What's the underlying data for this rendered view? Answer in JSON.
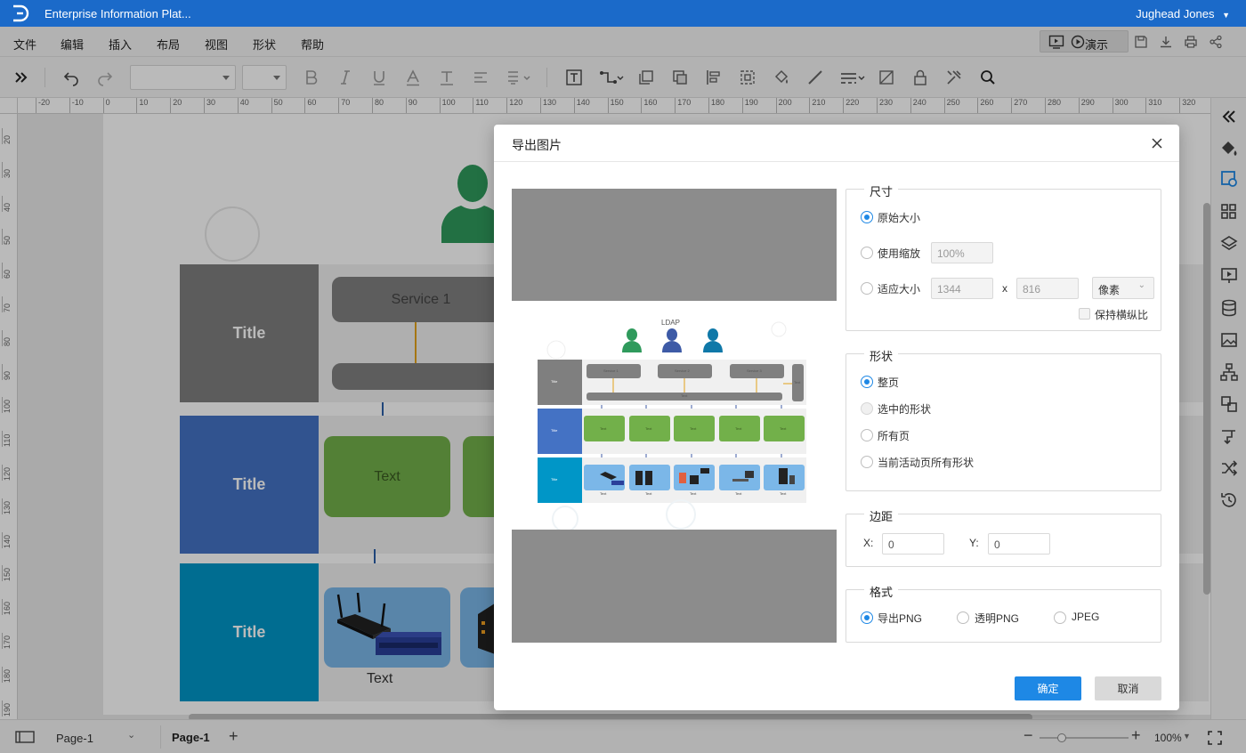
{
  "titlebar": {
    "app_title": "Enterprise Information Plat...",
    "user": "Jughead Jones"
  },
  "menu": {
    "items": [
      "文件",
      "编辑",
      "插入",
      "布局",
      "视图",
      "形状",
      "帮助"
    ],
    "present_label": "演示"
  },
  "ruler": {
    "h_ticks": [
      "-20",
      "-10",
      "0",
      "10",
      "20",
      "30",
      "40",
      "50",
      "60",
      "70",
      "80",
      "90",
      "100",
      "110",
      "120",
      "130",
      "140",
      "150",
      "160",
      "170",
      "180",
      "190",
      "200",
      "210",
      "220",
      "230",
      "240",
      "250",
      "260",
      "270",
      "280",
      "290",
      "300",
      "310",
      "320"
    ],
    "v_ticks": [
      "20",
      "30",
      "40",
      "50",
      "60",
      "70",
      "80",
      "90",
      "100",
      "110",
      "120",
      "130",
      "140",
      "150",
      "160",
      "170",
      "180",
      "190"
    ]
  },
  "canvas": {
    "titles": [
      "Title",
      "Title",
      "Title"
    ],
    "service_label": "Service 1",
    "green_label": "Text",
    "device_label": "Text"
  },
  "dialog": {
    "title": "导出图片",
    "preview": {
      "ldap": "LDAP",
      "lane_titles": [
        "Title",
        "Title",
        "Title"
      ],
      "services": [
        "Service 1",
        "Service 2",
        "Service 3"
      ],
      "bar_text": "Text",
      "green_texts": [
        "Text",
        "Text",
        "Text",
        "Text",
        "Text"
      ],
      "device_texts": [
        "Text",
        "Text",
        "Text",
        "Text",
        "Text"
      ],
      "side_text": "Text"
    },
    "size": {
      "legend": "尺寸",
      "original": "原始大小",
      "scale": "使用缩放",
      "scale_value": "100%",
      "fit": "适应大小",
      "width": "1344",
      "x_sep": "x",
      "height": "816",
      "unit": "像素",
      "keep_ratio": "保持横纵比",
      "selected": "original"
    },
    "shape": {
      "legend": "形状",
      "options": [
        "整页",
        "选中的形状",
        "所有页",
        "当前活动页所有形状"
      ],
      "selected": 0
    },
    "margin": {
      "legend": "边距",
      "x_label": "X:",
      "x_value": "0",
      "y_label": "Y:",
      "y_value": "0"
    },
    "format": {
      "legend": "格式",
      "options": [
        "导出PNG",
        "透明PNG",
        "JPEG"
      ],
      "selected": 0
    },
    "ok": "确定",
    "cancel": "取消"
  },
  "statusbar": {
    "page_select": "Page-1",
    "page_tab": "Page-1",
    "zoom": "100%"
  },
  "colors": {
    "brand": "#1b6ac9",
    "primary_button": "#1e88e5",
    "lane_gray": "#7f7f7f",
    "lane_blue": "#4472c4",
    "lane_cyan": "#0096c7",
    "green": "#72b04a",
    "device_blue": "#7bb7e8"
  },
  "icons": {
    "toolbar": [
      "expand-icon",
      "undo-icon",
      "redo-icon",
      "bold-icon",
      "italic-icon",
      "underline-icon",
      "font-color-icon",
      "text-style-icon",
      "align-icon",
      "spacing-icon",
      "textbox-icon",
      "connector-icon",
      "container-icon",
      "group-icon",
      "align-shapes-icon",
      "size-icon",
      "fill-icon",
      "line-icon",
      "line-style-icon",
      "shadow-icon",
      "lock-icon",
      "tools-icon",
      "search-icon"
    ],
    "right_panel": [
      "collapse-icon",
      "fill-panel-icon",
      "format-panel-icon",
      "grid-icon",
      "layers-icon",
      "presentation-icon",
      "data-icon",
      "image-icon",
      "org-icon",
      "replace-icon",
      "flowline-icon",
      "shuffle-icon",
      "history-icon"
    ]
  }
}
